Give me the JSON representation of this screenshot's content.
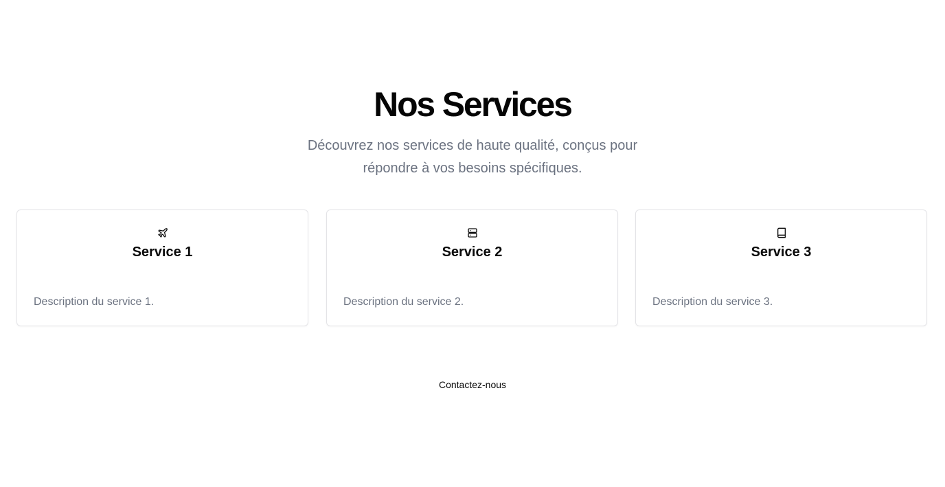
{
  "header": {
    "title": "Nos Services",
    "subtitle": "Découvrez nos services de haute qualité, conçus pour répondre à vos besoins spécifiques."
  },
  "services": [
    {
      "icon": "plane-icon",
      "title": "Service 1",
      "description": "Description du service 1."
    },
    {
      "icon": "server-icon",
      "title": "Service 2",
      "description": "Description du service 2."
    },
    {
      "icon": "book-icon",
      "title": "Service 3",
      "description": "Description du service 3."
    }
  ],
  "contact": {
    "label": "Contactez-nous"
  },
  "colors": {
    "text": "#0a0a0a",
    "muted": "#6b7280",
    "border": "#e4e4e7",
    "background": "#ffffff"
  }
}
